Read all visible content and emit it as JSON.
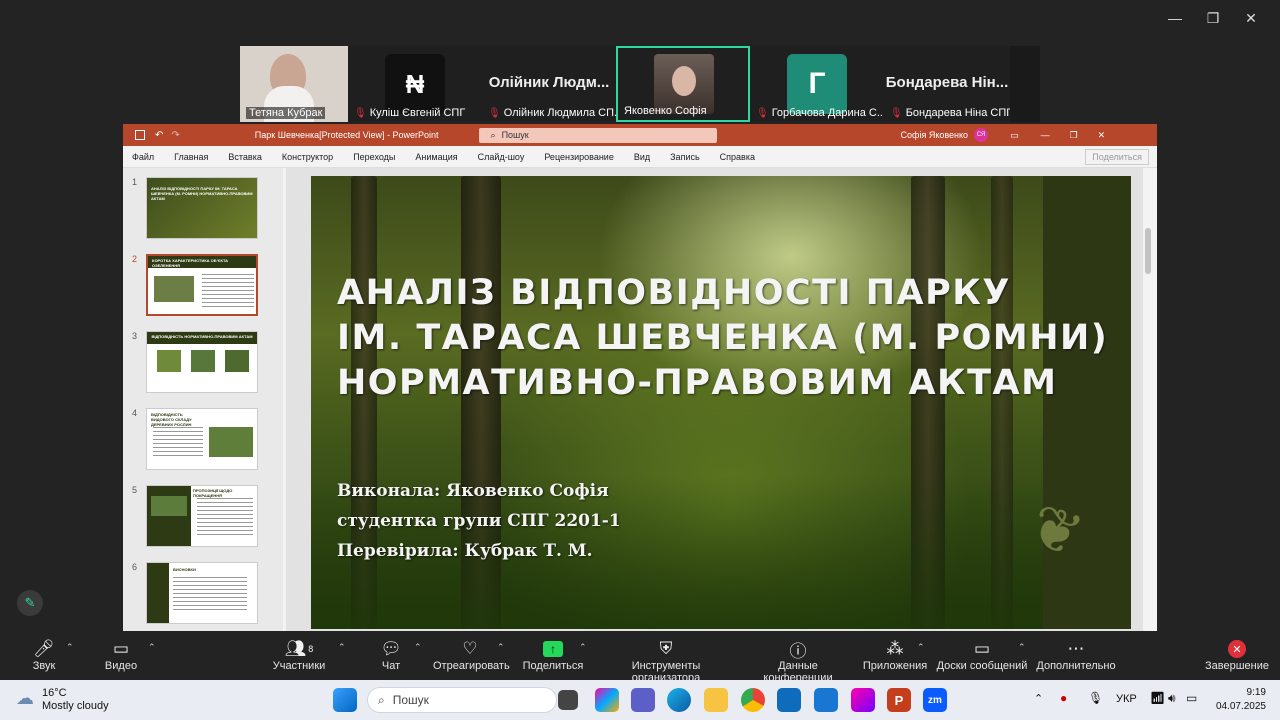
{
  "window_controls": {
    "minimize": "—",
    "restore": "❐",
    "close": "✕"
  },
  "participants": [
    {
      "name": "Тетяна Кубрак",
      "muted": false,
      "kind": "video"
    },
    {
      "name": "Куліш Євгеній СПГ",
      "muted": true,
      "kind": "logo",
      "logo_text": "ꟷ"
    },
    {
      "name": "Олійник Людмила СП...",
      "muted": true,
      "kind": "bigname",
      "big_name": "Олійник Людм..."
    },
    {
      "name": "Яковенко Софія",
      "muted": false,
      "kind": "video",
      "active": true
    },
    {
      "name": "Горбачова Дарина С...",
      "muted": true,
      "kind": "logo",
      "logo_text": "Г"
    },
    {
      "name": "Бондарева Ніна СПГ",
      "muted": true,
      "kind": "bigname",
      "big_name": "Бондарева Нін..."
    }
  ],
  "ppt": {
    "title": "Парк Шевченка[Protected View] - PowerPoint",
    "search_placeholder": "Пошук",
    "user": "Софія Яковенко",
    "user_initials": "СЯ",
    "menu": [
      "Файл",
      "Главная",
      "Вставка",
      "Конструктор",
      "Переходы",
      "Анимация",
      "Слайд-шоу",
      "Рецензирование",
      "Вид",
      "Запись",
      "Справка"
    ],
    "share": "Поделиться",
    "thumbnails": [
      "1",
      "2",
      "3",
      "4",
      "5",
      "6"
    ],
    "thumb_titles": [
      "АНАЛІЗ ВІДПОВІДНОСТІ ПАРКУ ІМ. ТАРАСА ШЕВЧЕНКА (М. РОМНИ) НОРМАТИВНО-ПРАВОВИМ АКТАМ",
      "КОРОТКА ХАРАКТЕРИСТИКА ОБ'ЄКТА ОЗЕЛЕНЕННЯ",
      "ВІДПОВІДНІСТЬ НОРМАТИВНО-ПРАВОВИМ АКТАМ",
      "ВІДПОВІДНІСТЬ ВИДОВОГО СКЛАДУ ДЕРЕВНИХ РОСЛИН",
      "ПРОПОЗИЦІЇ ЩОДО ПОКРАЩЕННЯ",
      "ВИСНОВКИ"
    ],
    "slide": {
      "title_lines": [
        "АНАЛІЗ ВІДПОВІДНОСТІ ПАРКУ",
        "ІМ. ТАРАСА ШЕВЧЕНКА (М. РОМНИ)",
        "НОРМАТИВНО-ПРАВОВИМ АКТАМ"
      ],
      "sub_lines": [
        "Виконала: Яковенко Софія",
        "студентка групи СПГ 2201-1",
        "Перевірила: Кубрак Т. М."
      ]
    }
  },
  "toolbar": {
    "items": [
      {
        "label": "Звук",
        "icon": "microphone-icon"
      },
      {
        "label": "Видео",
        "icon": "camera-icon"
      },
      {
        "label": "Участники",
        "icon": "participants-icon",
        "badge": "8"
      },
      {
        "label": "Чат",
        "icon": "chat-icon"
      },
      {
        "label": "Отреагировать",
        "icon": "heart-icon"
      },
      {
        "label": "Поделиться",
        "icon": "share-screen-icon"
      },
      {
        "label": "Инструменты организатора",
        "icon": "shield-icon"
      },
      {
        "label": "Данные конференции",
        "icon": "info-icon"
      },
      {
        "label": "Приложения",
        "icon": "apps-icon"
      },
      {
        "label": "Доски сообщений",
        "icon": "whiteboard-icon"
      },
      {
        "label": "Дополнительно",
        "icon": "more-icon"
      },
      {
        "label": "Завершение",
        "icon": "end-icon"
      }
    ]
  },
  "taskbar": {
    "weather_temp": "16°C",
    "weather_desc": "Mostly cloudy",
    "search_placeholder": "Пошук",
    "lang": "УКР",
    "time": "9:19",
    "date": "04.07.2025",
    "zoom_label": "zm"
  },
  "colors": {
    "ppt_accent": "#b7472a",
    "active_speaker": "#2bd9a3",
    "share_green": "#23d959",
    "end_red": "#e0313b"
  }
}
